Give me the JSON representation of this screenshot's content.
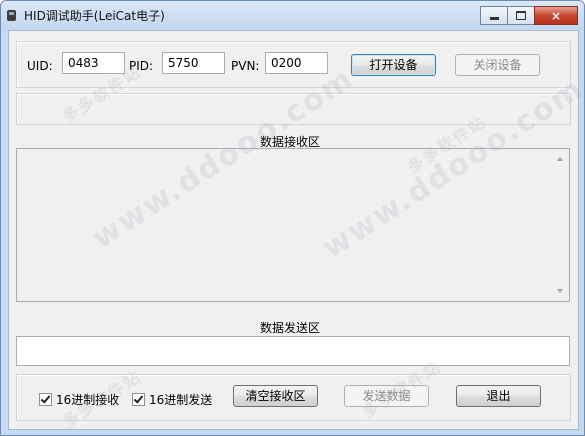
{
  "window": {
    "title": "HID调试助手(LeiCat电子)",
    "controls": {
      "minimize": "minimize",
      "maximize": "maximize",
      "close": "×"
    }
  },
  "device": {
    "uid_label": "UID:",
    "uid_value": "0483",
    "pid_label": "PID:",
    "pid_value": "5750",
    "pvn_label": "PVN:",
    "pvn_value": "0200",
    "open_button": "打开设备",
    "close_button": "关闭设备"
  },
  "receive": {
    "label": "数据接收区",
    "content": ""
  },
  "send": {
    "label": "数据发送区",
    "content": ""
  },
  "bottom": {
    "hex_receive_label": "16进制接收",
    "hex_receive_checked": true,
    "hex_send_label": "16进制发送",
    "hex_send_checked": true,
    "clear_button": "清空接收区",
    "send_button": "发送数据",
    "exit_button": "退出"
  },
  "watermark": {
    "text1": "多多软件站",
    "text2": "www.ddooo.com"
  },
  "colors": {
    "title_bar": "#c9dbf0",
    "close_button": "#c7462f",
    "client_bg": "#f0f0f0",
    "focus_border": "#3c7fb1"
  }
}
